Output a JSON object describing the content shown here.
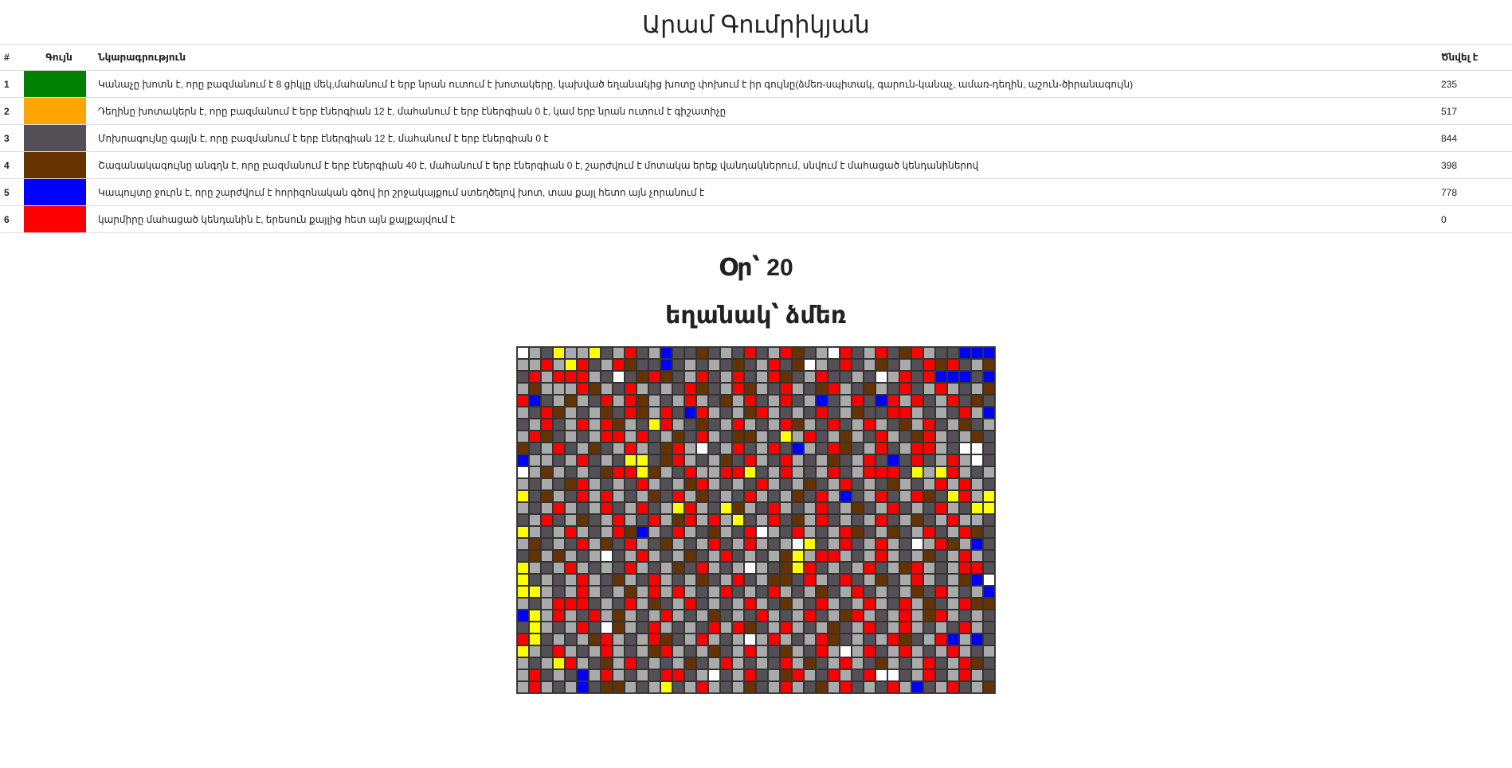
{
  "page": {
    "title": "Արամ Գումրիկյան",
    "day_label": "Օր՝ 20",
    "season_label": "եղանակ՝ ձմեռ"
  },
  "legend": {
    "headers": {
      "index": "#",
      "color": "Գույն",
      "description": "Նկարագրություն",
      "count": "Ծնվել է"
    },
    "rows": [
      {
        "index": "1",
        "color": "#008000",
        "description": "Կանաչը խոտն է, որը բազմանում է 8 ցիկլը մեկ,մահանում է երբ նրան ուտում է խոտակերը, կախված եղանակից խոտը փոխում է իր գույնը(ձմեռ-սպիտակ, գարուն-կանաչ, ամառ-դեղին, աշուն-ծիրանագույն)",
        "count": "235"
      },
      {
        "index": "2",
        "color": "#FFA500",
        "description": "Դեղինը խոտակերն է, որը բազմանում է երբ էներգիան 12 է, մահանում է երբ էներգիան 0 է, կամ երբ նրան ուտում է գիշատիչը",
        "count": "517"
      },
      {
        "index": "3",
        "color": "#555055",
        "description": "Մոխրագույնը գայլն է, որը բազմանում է երբ էներգիան 12 է, մահանում է երբ էներգիան 0 է",
        "count": "844"
      },
      {
        "index": "4",
        "color": "#663300",
        "description": "Շագանակագույնը անգղն է, որը բազմանում է երբ էներգիան 40 է, մահանում է երբ էներգիան 0 է, շարժվում է մոտակա երեք վանդակներում, սնվում է մահացած կենդանիներով",
        "count": "398"
      },
      {
        "index": "5",
        "color": "#0000FF",
        "description": "Կապույտը ջուրն է, որը շարժվում է հորիզոնական գծով իր շրջակայքում ստեղծելով խոտ, տաս քայլ հետո այն չորանում է",
        "count": "778"
      },
      {
        "index": "6",
        "color": "#FF0000",
        "description": "կարմիրը մահացած կենդանին է, երեսուն քայլից հետ այն քայքայվում է",
        "count": "0"
      }
    ]
  },
  "grid_data": {
    "columns": 40,
    "rows": 29,
    "palette": {
      "w": "#FFFFFF",
      "g": "#AAAAAA",
      "d": "#555055",
      "r": "#FF0000",
      "b": "#663300",
      "u": "#0000FF",
      "y": "#FFFF00"
    },
    "cells": [
      "wgdyggydgrdguddbdgdrdgrbdgwrdgrdbrgdduuu",
      "ggrgyrdgrbddudgdgdbdgrdbwgdrdgbdgdrbrdgb",
      "drgrrrgdwdbrbdgrdgrdgrbdgrddgdwgrdruuudu",
      "gbgggrbgdrgdgdrbdgrbgdrgdbrgdbgdrdgrgdgb",
      "rudgbgdrgrbgdgrgdbgrdgrdgudgrdurgrdgrdbd",
      "gdrbgdgbdrbgrdurgdgbrgdgdrdgbddrrgdgdrgu",
      "dgrdgrgrbgdyrgdbdgrgdgrbgdrdgrgdbgrdgbdg",
      "grbdgdgrrgrdgbdrgdbbgdygrdgbgdrgdbrgdgbd",
      "bdgrdgbdgrgdbrgwdgrdgrdugdrbdgrdgrrgdwwd",
      "uggdgrdgdyydbrgdgbdrgdrgdgbdgrdudrdgrgwd",
      "wgbgdgdbrrybgdrggrrydgrgdgrdgrrrdygyrgdg",
      "gdgdbrgdgdrgdgbrgdgdrgdgbdgrdgdbgdgrgrgd",
      "ydbgdrgrgdgbdrgbdgdrgdgbdrgudgrdgrbdyrgy",
      "gdgrgdgrdgrdgyrgdybgdrgdgrdgbdgrdgdrgdyy",
      "dgrdgbdgrgdrgbrgrgydgrdbgrdgdgrdgbdgrggd",
      "ygdgrgdgrbugdrgdbgdrwgdrgdgrbdgbdgrdgrbd",
      "gbdgdrgbdrgdbgdgrdgrgdgwydgrdgrgdwgrbgud",
      "dbgbgdgwdgrgdgbdgrdgdgbygrrgdgrgdgbdgrgd",
      "ygdgrgdgdrgdgbdrgdgwgdbyrdgdgrdgbrgdgrrd",
      "ydgdgrgdbgdrgdgbdgrdgbbdrgdrdgbdgrgdgbuw",
      "yygdgrgdgbgrgrgdgrdgdrgdgbdgrdgdgbdrgdgu",
      "gdgrrrdgdrgbdgrdgdgrgdbgdrgdgrgdrgbdgrbb",
      "uygrgdrgbgdgrgdgbdgdrgdgrdgbrgdgrgbrgdgd",
      "dygdgrdwbgdrgdgdrgrbdgrgdgbdgrdgrgdgdrgd",
      "rydgdgbrgdgrbdgrgdgwgrgdgrbdgdgrbdgrugud",
      "ygdrgdgrgdgbrgdgbdgrgdbgdrgwgrdgrgdgrgdg",
      "gdgyrgdbgrdgdgbdgrgdgdrgbdgrgdbgdgrdgrbd",
      "grdgdugrgdgdrrdgwdgrdgbrgdrgdrwwdgrdgrgd",
      "grgdgudbbgdgydgrgdgbdgrgdbgrdgdrgudgrdgb"
    ]
  }
}
